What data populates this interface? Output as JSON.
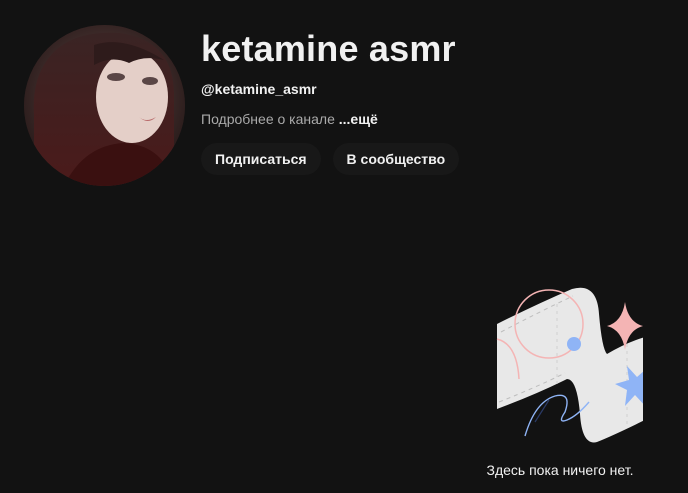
{
  "channel": {
    "title": "ketamine asmr",
    "handle": "@ketamine_asmr",
    "description_prefix": "Подробнее о канале ",
    "description_more": "...ещё"
  },
  "actions": {
    "subscribe_label": "Подписаться",
    "community_label": "В сообщество"
  },
  "empty_state": {
    "message": "Здесь пока ничего нет."
  },
  "colors": {
    "background": "#121212",
    "text_primary": "#f1f1f1",
    "text_secondary": "#aaaaaa",
    "button_bg": "#181818",
    "illustration_paper": "#e8e8e8",
    "illustration_pink": "#f4b4b4",
    "illustration_blue": "#8fb4f6"
  }
}
